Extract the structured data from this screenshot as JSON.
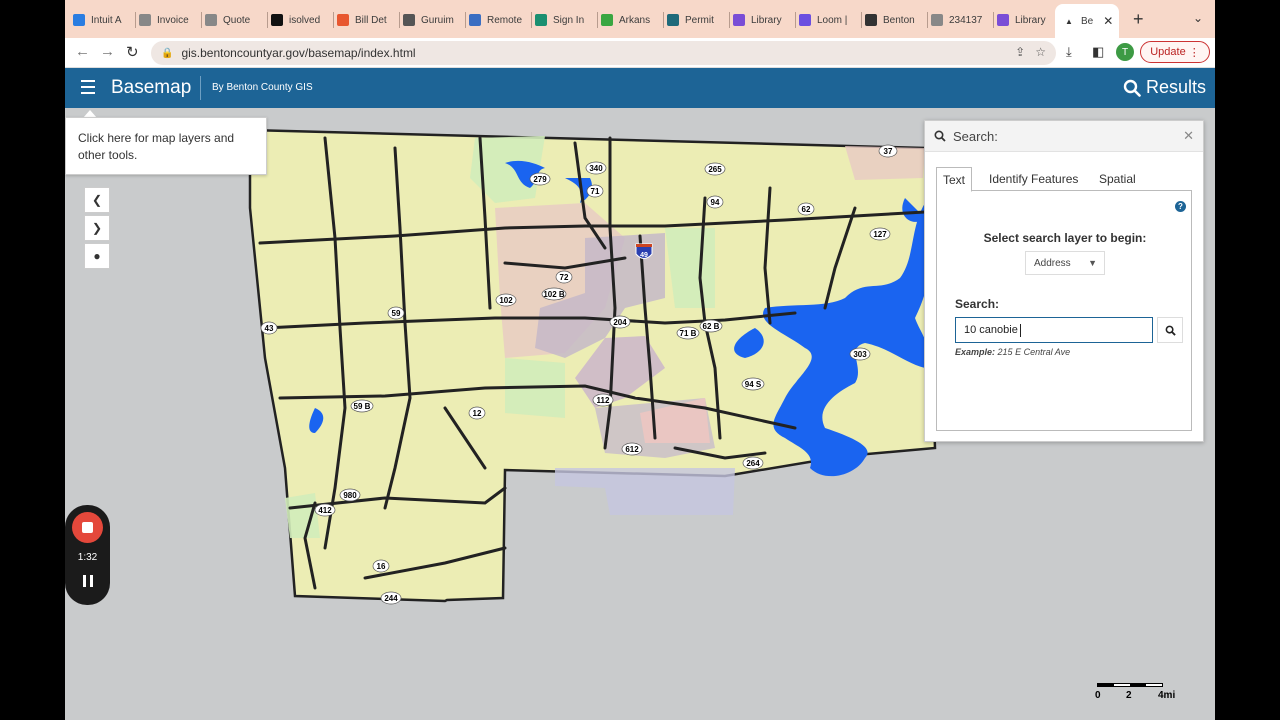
{
  "browser": {
    "tabs": [
      {
        "label": "Intuit A",
        "color": "#2a7de1"
      },
      {
        "label": "Invoice",
        "color": "#888888"
      },
      {
        "label": "Quote",
        "color": "#888888"
      },
      {
        "label": "isolved",
        "color": "#111111"
      },
      {
        "label": "Bill Det",
        "color": "#e8572f"
      },
      {
        "label": "Guruim",
        "color": "#555555"
      },
      {
        "label": "Remote",
        "color": "#3b6ec2"
      },
      {
        "label": "Sign In",
        "color": "#1a8f70"
      },
      {
        "label": "Arkans",
        "color": "#3aa641"
      },
      {
        "label": "Permit",
        "color": "#1f6a7a"
      },
      {
        "label": "Library",
        "color": "#7a4dd6"
      },
      {
        "label": "Loom |",
        "color": "#6b4fe0"
      },
      {
        "label": "Benton",
        "color": "#333333"
      },
      {
        "label": "234137",
        "color": "#888888"
      },
      {
        "label": "Library",
        "color": "#7a4dd6"
      }
    ],
    "active_tab": "Be",
    "url": "gis.bentoncountyar.gov/basemap/index.html",
    "avatar_letter": "T",
    "update_label": "Update"
  },
  "app": {
    "title": "Basemap",
    "subtitle": "By Benton County GIS",
    "results_label": "Results"
  },
  "tooltip": {
    "text": "Click here for map layers and other tools."
  },
  "recorder": {
    "time": "1:32"
  },
  "search_panel": {
    "title": "Search:",
    "tabs": [
      "Text",
      "Identify Features",
      "Spatial"
    ],
    "active_tab": "Text",
    "layer_prompt": "Select search layer to begin:",
    "layer_value": "Address",
    "search_label": "Search:",
    "search_value": "10 canobie",
    "example_label": "Example:",
    "example_value": "215 E Central Ave"
  },
  "map": {
    "highway_labels": [
      "37",
      "340",
      "265",
      "279",
      "71",
      "94",
      "62",
      "127",
      "49",
      "72",
      "102 B",
      "102",
      "59",
      "43",
      "204",
      "71 B",
      "62 B",
      "303",
      "94 S",
      "59 B",
      "12",
      "112",
      "612",
      "264",
      "980",
      "412",
      "16",
      "244"
    ],
    "colors": {
      "land": "#ecedb4",
      "water": "#1a64f0",
      "city": "#c7a8a8",
      "urban": "#bbb0c5"
    }
  },
  "scale_bar": {
    "labels": [
      "0",
      "2",
      "4mi"
    ]
  }
}
